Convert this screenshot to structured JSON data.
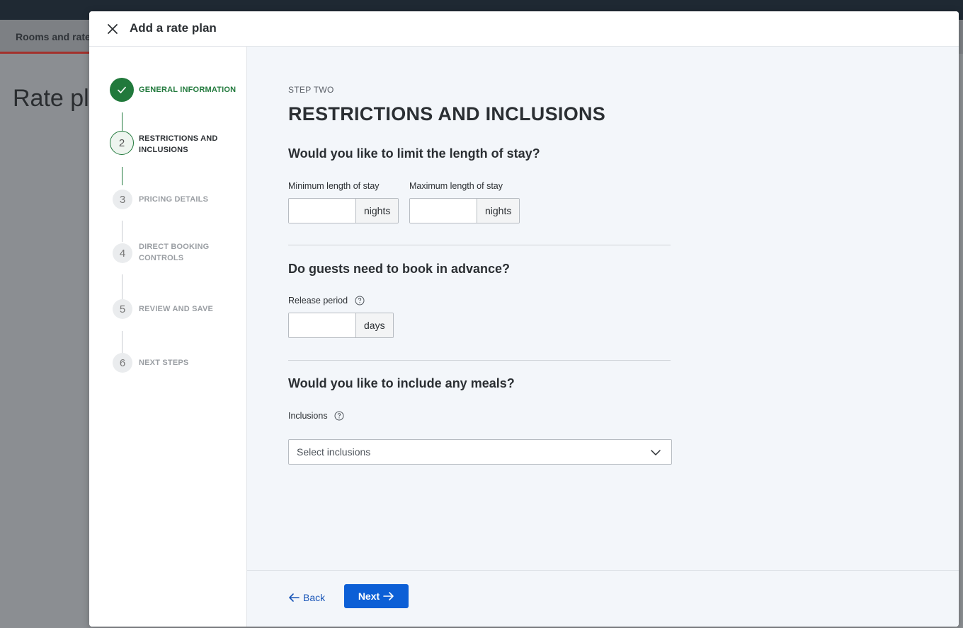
{
  "background": {
    "tab_label": "Rooms and rates",
    "page_title": "Rate plans"
  },
  "modal": {
    "title": "Add a rate plan",
    "close_icon": "close-icon"
  },
  "stepper": {
    "steps": [
      {
        "number": "1",
        "label": "GENERAL INFORMATION",
        "state": "done"
      },
      {
        "number": "2",
        "label": "RESTRICTIONS AND INCLUSIONS",
        "state": "active"
      },
      {
        "number": "3",
        "label": "PRICING DETAILS",
        "state": "todo"
      },
      {
        "number": "4",
        "label": "DIRECT BOOKING CONTROLS",
        "state": "todo"
      },
      {
        "number": "5",
        "label": "REVIEW AND SAVE",
        "state": "todo"
      },
      {
        "number": "6",
        "label": "NEXT STEPS",
        "state": "todo"
      }
    ]
  },
  "content": {
    "kicker": "STEP TWO",
    "title": "RESTRICTIONS AND INCLUSIONS",
    "length_of_stay": {
      "question": "Would you like to limit the length of stay?",
      "min_label": "Minimum length of stay",
      "min_value": "",
      "min_unit": "nights",
      "max_label": "Maximum length of stay",
      "max_value": "",
      "max_unit": "nights"
    },
    "advance": {
      "question": "Do guests need to book in advance?",
      "release_label": "Release period",
      "release_value": "",
      "release_unit": "days"
    },
    "meals": {
      "question": "Would you like to include any meals?",
      "inclusions_label": "Inclusions",
      "inclusions_placeholder": "Select inclusions"
    }
  },
  "footer": {
    "back_label": "Back",
    "next_label": "Next"
  },
  "colors": {
    "accent_green": "#21793c",
    "primary_blue": "#0c5fd6",
    "link_blue": "#1a56b8"
  }
}
